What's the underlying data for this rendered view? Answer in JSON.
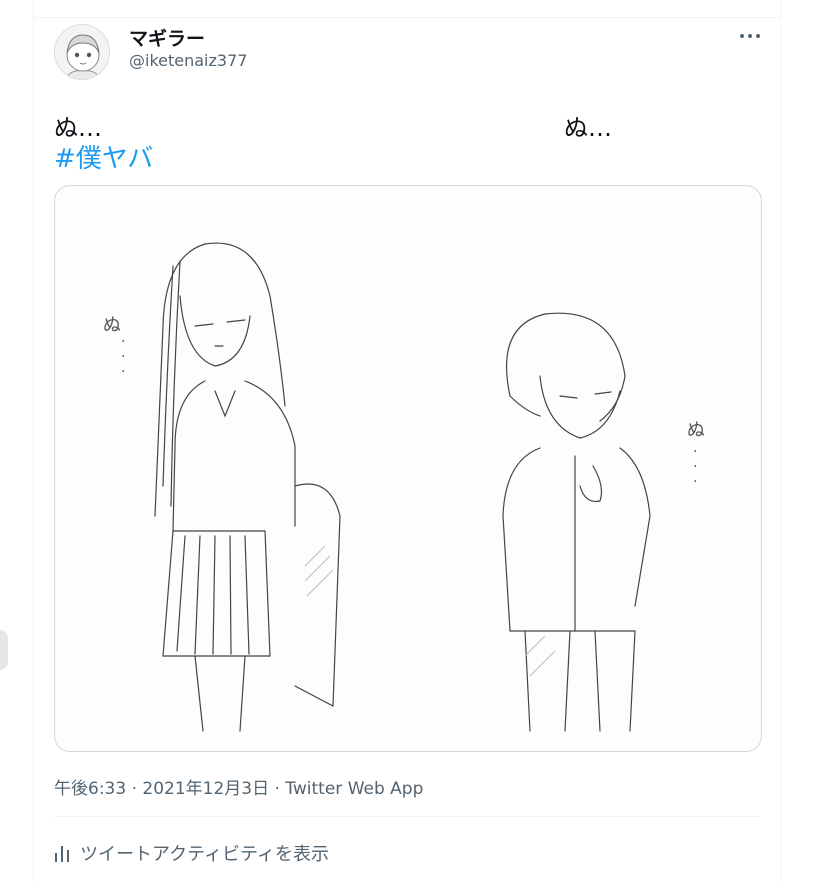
{
  "tweet": {
    "display_name": "マギラー",
    "handle": "@iketenaiz377",
    "text_left": "ぬ…",
    "text_right": "ぬ…",
    "hashtag": "#僕ヤバ",
    "timestamp": "午後6:33 · 2021年12月3日 · Twitter Web App",
    "activity_label": "ツイートアクティビティを表示",
    "more_icon": "more-horizontal-icon",
    "activity_icon": "bar-chart-icon",
    "accent_color": "#1d9bf0"
  },
  "media": {
    "sketch_text_left": "ぬ",
    "sketch_text_right": "ぬ"
  }
}
